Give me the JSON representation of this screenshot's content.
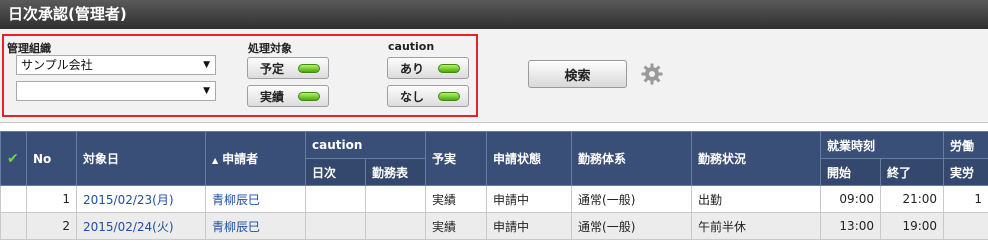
{
  "title": "日次承認(管理者)",
  "filters": {
    "org_label": "管理組織",
    "org_value": "サンプル会社",
    "org_sub_value": "",
    "target_label": "処理対象",
    "target_yotei": "予定",
    "target_jisseki": "実績",
    "caution_label": "caution",
    "caution_ari": "あり",
    "caution_nashi": "なし",
    "search_label": "検索",
    "arrow": "▼"
  },
  "icons": {
    "check": "check-icon",
    "gear": "gear-icon",
    "sort": "sort-asc-icon"
  },
  "colors": {
    "header_bg": "#3a4f77",
    "titlebar": "#3a3a3a",
    "led": "#5fc21a",
    "highlight": "#e0242a"
  },
  "table": {
    "headers": {
      "no": "No",
      "date": "対象日",
      "sort_mark": "▲",
      "applicant": "申請者",
      "caution": "caution",
      "yojitsu": "予実",
      "status": "申請状態",
      "work_system": "勤務体系",
      "work_state": "勤務状況",
      "work_time": "就業時刻",
      "labor": "労働"
    },
    "subheaders": {
      "nichiji": "日次",
      "kinmuhyo": "勤務表",
      "start": "開始",
      "end": "終了",
      "actual": "実労"
    },
    "rows": [
      {
        "no": "1",
        "date": "2015/02/23(月)",
        "applicant": "青柳辰巳",
        "nichiji": "",
        "kinmuhyo": "",
        "yojitsu": "実績",
        "status": "申請中",
        "system": "通常(一般)",
        "state": "出勤",
        "start": "09:00",
        "end": "21:00",
        "actual": "1"
      },
      {
        "no": "2",
        "date": "2015/02/24(火)",
        "applicant": "青柳辰巳",
        "nichiji": "",
        "kinmuhyo": "",
        "yojitsu": "実績",
        "status": "申請中",
        "system": "通常(一般)",
        "state": "午前半休",
        "start": "13:00",
        "end": "19:00",
        "actual": ""
      }
    ]
  }
}
